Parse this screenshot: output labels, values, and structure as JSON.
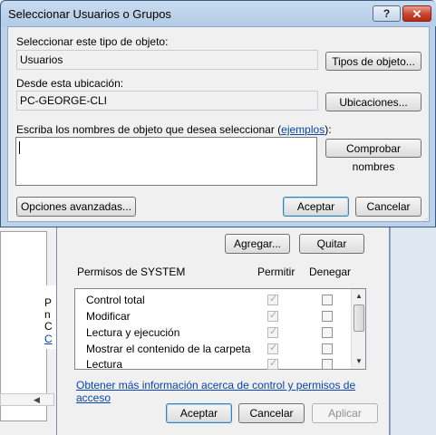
{
  "select_dialog": {
    "title": "Seleccionar Usuarios o Grupos",
    "help_button": "?",
    "close_button": "✕",
    "object_type_label": "Seleccionar este tipo de objeto:",
    "object_type_value": "Usuarios",
    "object_types_button": "Tipos de objeto...",
    "location_label": "Desde esta ubicación:",
    "location_value": "PC-GEORGE-CLI",
    "locations_button": "Ubicaciones...",
    "names_label_prefix": "Escriba los nombres de objeto que desea seleccionar (",
    "names_label_link": "ejemplos",
    "names_label_suffix": "):",
    "names_value": "",
    "check_names_button": "Comprobar nombres",
    "advanced_button": "Opciones avanzadas...",
    "ok_button": "Aceptar",
    "cancel_button": "Cancelar"
  },
  "permissions_dialog": {
    "add_button": "Agregar...",
    "remove_button": "Quitar",
    "permissions_for": "Permisos de SYSTEM",
    "allow_header": "Permitir",
    "deny_header": "Denegar",
    "rows": [
      {
        "label": "Control total",
        "allow": true,
        "deny": false
      },
      {
        "label": "Modificar",
        "allow": true,
        "deny": false
      },
      {
        "label": "Lectura y ejecución",
        "allow": true,
        "deny": false
      },
      {
        "label": "Mostrar el contenido de la carpeta",
        "allow": true,
        "deny": false
      },
      {
        "label": "Lectura",
        "allow": true,
        "deny": false
      }
    ],
    "more_info_link": "Obtener más información acerca de control y permisos de acceso",
    "ok_button": "Aceptar",
    "cancel_button": "Cancelar",
    "apply_button": "Aplicar"
  },
  "background_window": {
    "fragments": [
      "P",
      "n",
      "C",
      "C"
    ]
  },
  "colors": {
    "title_bar": "#bcd2ea",
    "close_button": "#c8442c",
    "link": "#0645ad",
    "dialog_face": "#f0f0f0"
  }
}
